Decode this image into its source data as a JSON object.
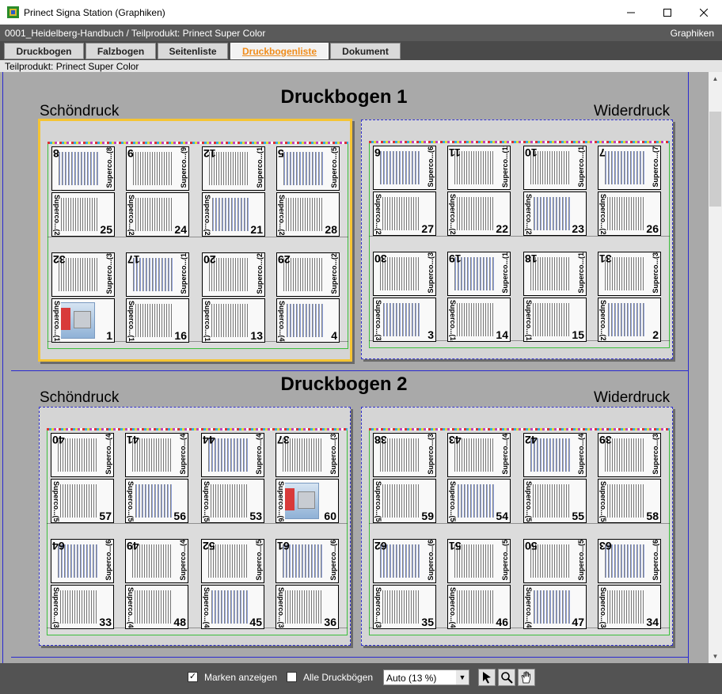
{
  "window": {
    "title": "Prinect Signa Station (Graphiken)"
  },
  "infobar": {
    "path": "0001_Heidelberg-Handbuch / Teilprodukt: Prinect Super Color",
    "mode": "Graphiken"
  },
  "tabs": [
    {
      "label": "Druckbogen",
      "active": false
    },
    {
      "label": "Falzbogen",
      "active": false
    },
    {
      "label": "Seitenliste",
      "active": false
    },
    {
      "label": "Druckbogenliste",
      "active": true
    },
    {
      "label": "Dokument",
      "active": false
    }
  ],
  "subtitle": "Teilprodukt: Prinect Super Color",
  "sheets": [
    {
      "title": "Druckbogen 1",
      "front_label": "Schöndruck",
      "back_label": "Widerdruck",
      "front_pages": [
        {
          "num": "8",
          "lbl": "Superco...(8)"
        },
        {
          "num": "9",
          "lbl": "Superco...(9)"
        },
        {
          "num": "12",
          "lbl": "Superco...(12)"
        },
        {
          "num": "5",
          "lbl": "Superco...(5)"
        },
        {
          "num": "25",
          "lbl": "Superco...(25)"
        },
        {
          "num": "24",
          "lbl": "Superco...(24)"
        },
        {
          "num": "21",
          "lbl": "Superco...(21)"
        },
        {
          "num": "28",
          "lbl": "Superco...(28)"
        },
        {
          "num": "32",
          "lbl": "Superco...(32)"
        },
        {
          "num": "17",
          "lbl": "Superco...(17)"
        },
        {
          "num": "20",
          "lbl": "Superco...(20)"
        },
        {
          "num": "29",
          "lbl": "Superco...(29)"
        },
        {
          "num": "1",
          "lbl": "Superco...(1)"
        },
        {
          "num": "16",
          "lbl": "Superco...(16)"
        },
        {
          "num": "13",
          "lbl": "Superco...(13)"
        },
        {
          "num": "4",
          "lbl": "Superco...(4)"
        }
      ],
      "back_pages": [
        {
          "num": "6",
          "lbl": "Superco...(6)"
        },
        {
          "num": "11",
          "lbl": "Superco...(11)"
        },
        {
          "num": "10",
          "lbl": "Superco...(10)"
        },
        {
          "num": "7",
          "lbl": "Superco...(7)"
        },
        {
          "num": "27",
          "lbl": "Superco...(27)"
        },
        {
          "num": "22",
          "lbl": "Superco...(22)"
        },
        {
          "num": "23",
          "lbl": "Superco...(23)"
        },
        {
          "num": "26",
          "lbl": "Superco...(26)"
        },
        {
          "num": "30",
          "lbl": "Superco...(30)"
        },
        {
          "num": "19",
          "lbl": "Superco...(19)"
        },
        {
          "num": "18",
          "lbl": "Superco...(18)"
        },
        {
          "num": "31",
          "lbl": "Superco...(31)"
        },
        {
          "num": "3",
          "lbl": "Superco...(3)"
        },
        {
          "num": "14",
          "lbl": "Superco...(14)"
        },
        {
          "num": "15",
          "lbl": "Superco...(15)"
        },
        {
          "num": "2",
          "lbl": "Superco...(2)"
        }
      ]
    },
    {
      "title": "Druckbogen 2",
      "front_label": "Schöndruck",
      "back_label": "Widerdruck",
      "front_pages": [
        {
          "num": "40",
          "lbl": "Superco...(40)"
        },
        {
          "num": "41",
          "lbl": "Superco...(41)"
        },
        {
          "num": "44",
          "lbl": "Superco...(44)"
        },
        {
          "num": "37",
          "lbl": "Superco...(37)"
        },
        {
          "num": "57",
          "lbl": "Superco...(57)"
        },
        {
          "num": "56",
          "lbl": "Superco...(56)"
        },
        {
          "num": "53",
          "lbl": "Superco...(53)"
        },
        {
          "num": "60",
          "lbl": "Superco...(60)"
        },
        {
          "num": "64",
          "lbl": "Superco...(64)"
        },
        {
          "num": "49",
          "lbl": "Superco...(49)"
        },
        {
          "num": "52",
          "lbl": "Superco...(52)"
        },
        {
          "num": "61",
          "lbl": "Superco...(61)"
        },
        {
          "num": "33",
          "lbl": "Superco...(33)"
        },
        {
          "num": "48",
          "lbl": "Superco...(48)"
        },
        {
          "num": "45",
          "lbl": "Superco...(45)"
        },
        {
          "num": "36",
          "lbl": "Superco...(36)"
        }
      ],
      "back_pages": [
        {
          "num": "38",
          "lbl": "Superco...(38)"
        },
        {
          "num": "43",
          "lbl": "Superco...(43)"
        },
        {
          "num": "42",
          "lbl": "Superco...(42)"
        },
        {
          "num": "39",
          "lbl": "Superco...(39)"
        },
        {
          "num": "59",
          "lbl": "Superco...(59)"
        },
        {
          "num": "54",
          "lbl": "Superco...(54)"
        },
        {
          "num": "55",
          "lbl": "Superco...(55)"
        },
        {
          "num": "58",
          "lbl": "Superco...(58)"
        },
        {
          "num": "62",
          "lbl": "Superco...(62)"
        },
        {
          "num": "51",
          "lbl": "Superco...(51)"
        },
        {
          "num": "50",
          "lbl": "Superco...(50)"
        },
        {
          "num": "63",
          "lbl": "Superco...(63)"
        },
        {
          "num": "35",
          "lbl": "Superco...(35)"
        },
        {
          "num": "46",
          "lbl": "Superco...(46)"
        },
        {
          "num": "47",
          "lbl": "Superco...(47)"
        },
        {
          "num": "34",
          "lbl": "Superco...(34)"
        }
      ]
    }
  ],
  "bottombar": {
    "show_marks_label": "Marken anzeigen",
    "show_marks_checked": true,
    "all_sheets_label": "Alle Druckbögen",
    "all_sheets_checked": false,
    "zoom_value": "Auto (13 %)"
  },
  "icons": [
    "app-icon",
    "minimize-icon",
    "maximize-icon",
    "close-icon",
    "pointer-tool-icon",
    "zoom-tool-icon",
    "hand-tool-icon",
    "scroll-up-icon",
    "scroll-down-icon"
  ]
}
